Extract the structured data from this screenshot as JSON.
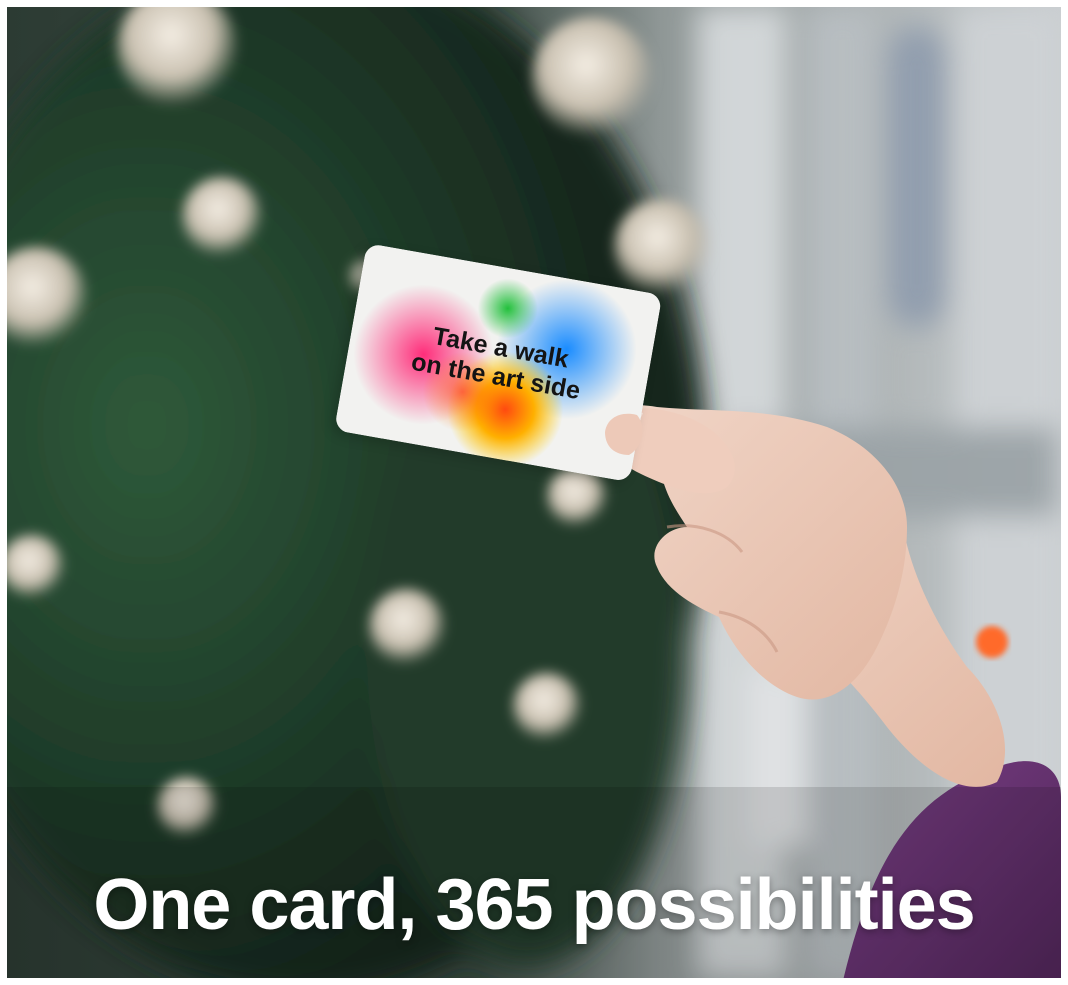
{
  "card": {
    "line1": "Take a walk",
    "line2": "on the art side"
  },
  "headline": "One card, 365 possibilities"
}
